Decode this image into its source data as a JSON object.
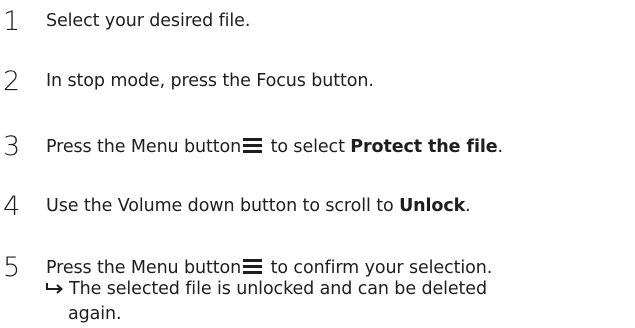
{
  "steps": [
    {
      "number": "1",
      "before": "Select your desired file.",
      "after": "",
      "bold": "",
      "end": ""
    },
    {
      "number": "2",
      "before": "In stop mode, press the Focus button.",
      "after": "",
      "bold": "",
      "end": ""
    },
    {
      "number": "3",
      "before": "Press the Menu button",
      "after": " to select ",
      "bold": "Protect the file",
      "end": "."
    },
    {
      "number": "4",
      "before": "Use the Volume down button to scroll to ",
      "after": "",
      "bold": "Unlock",
      "end": "."
    },
    {
      "number": "5",
      "before": "Press the Menu button",
      "after": " to confirm your selection.",
      "bold": "",
      "end": ""
    }
  ],
  "result": {
    "line1": "The selected file is unlocked and can be deleted",
    "line2": "again."
  },
  "icons": {
    "menu": "menu-icon",
    "result": "arrow-right-icon"
  }
}
